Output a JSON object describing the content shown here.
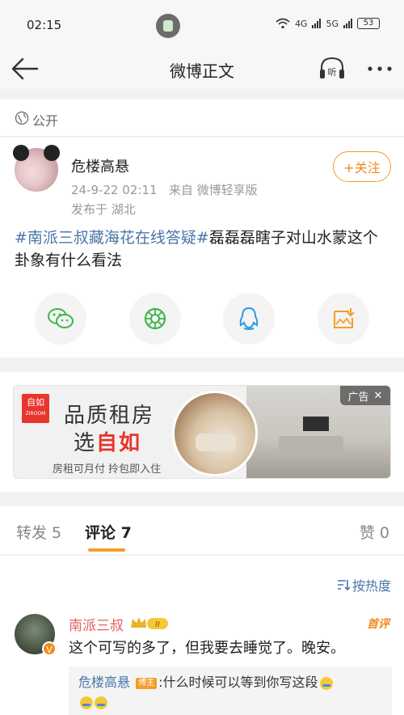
{
  "status": {
    "time": "02:15",
    "net1": "4G",
    "net2": "5G",
    "battery": "53"
  },
  "nav": {
    "title": "微博正文",
    "listen_label": "听"
  },
  "visibility": {
    "label": "公开"
  },
  "post": {
    "author": "危楼高悬",
    "timestamp": "24-9-22 02:11",
    "source": "来自 微博轻享版",
    "location": "发布于 湖北",
    "follow_label": "+关注",
    "hashtag": "#南派三叔藏海花在线答疑#",
    "body": "磊磊磊瞎子对山水蒙这个卦象有什么看法"
  },
  "share": [
    "wechat-icon",
    "moments-icon",
    "qq-icon",
    "save-image-icon"
  ],
  "ad": {
    "badge": "广告",
    "logo_top": "自如",
    "logo_bottom": "ZIROOM",
    "headline1": "品质租房",
    "headline2_prefix": "选",
    "headline2_brand": "自如",
    "subline": "房租可月付   拎包即入住"
  },
  "tabs": {
    "repost": "转发 5",
    "comment": "评论 7",
    "like": "赞 0"
  },
  "comments": {
    "sort_label": "按热度",
    "first_label": "首评",
    "items": [
      {
        "user": "南派三叔",
        "level": "II",
        "text": "这个可写的多了，但我要去睡觉了。晚安。",
        "reply_user": "危楼高悬",
        "reply_badge": "博主",
        "reply_text": ":什么时候可以等到你写这段"
      }
    ]
  },
  "colors": {
    "accent": "#f59d2a",
    "link": "#4a76a8",
    "name_red": "#e35f5f",
    "brand_red": "#e8352e"
  }
}
